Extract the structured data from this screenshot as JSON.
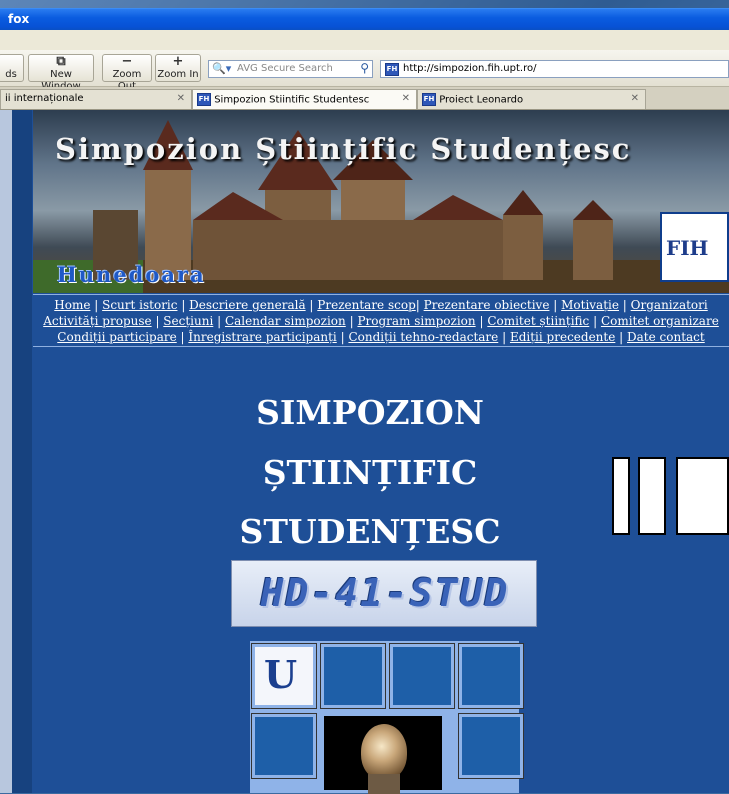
{
  "window": {
    "title_fragment": "fox"
  },
  "toolbar": {
    "partial_label": "ds",
    "buttons": [
      {
        "name": "new-window",
        "label": "New Window"
      },
      {
        "name": "zoom-out",
        "label": "Zoom Out"
      },
      {
        "name": "zoom-in",
        "label": "Zoom In"
      }
    ],
    "search_placeholder": "AVG Secure Search",
    "url": "http://simpozion.fih.upt.ro/"
  },
  "tabs": [
    {
      "label": "ii internaționale",
      "active": false
    },
    {
      "label": "Simpozion Stiintific Studentesc",
      "active": true
    },
    {
      "label": "Proiect Leonardo",
      "active": false
    }
  ],
  "banner": {
    "title": "Simpozion Științific Studențesc",
    "city": "Hunedoara",
    "logo_text": "FIH"
  },
  "nav": {
    "row1": [
      "Home",
      "Scurt istoric",
      "Descriere generală",
      "Prezentare scop",
      "Prezentare obiective",
      "Motivație",
      "Organizatori"
    ],
    "row2": [
      "Activități propuse",
      "Secțiuni",
      "Calendar simpozion",
      "Program simpozion",
      "Comitet științific",
      "Comitet organizare"
    ],
    "row3": [
      "Condiții participare",
      "Înregistrare participanți",
      "Condiții tehno-redactare",
      "Ediții precedente",
      "Date contact"
    ]
  },
  "main": {
    "heading_line1": "SIMPOZION",
    "heading_line2": "ȘTIINȚIFIC",
    "heading_line3": "STUDENȚESC",
    "code": "HD-41-STUD",
    "ut_logo": "U"
  },
  "colors": {
    "page_bg": "#1e4f97",
    "grid_bg": "#8fb3e8",
    "title_bar": "#0a5ce0"
  }
}
